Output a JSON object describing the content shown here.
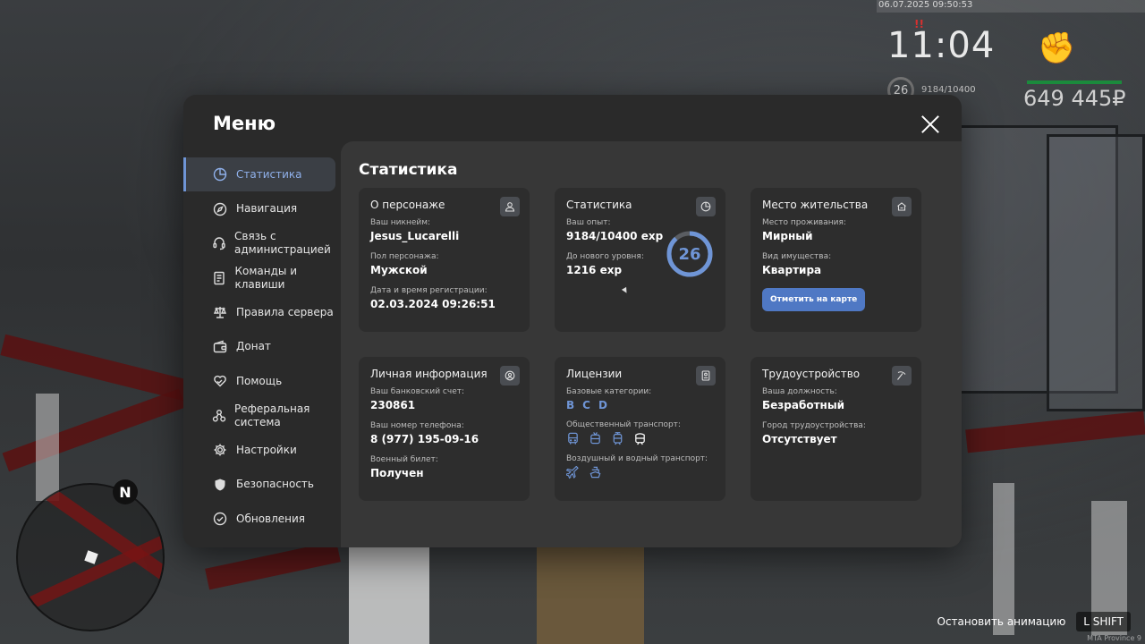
{
  "hud": {
    "datetime": "06.07.2025 09:50:53",
    "alert": "!!",
    "time": "11:04",
    "level": "26",
    "exp": "9184/10400",
    "money": "649 445₽",
    "health_color": "#1b8a3c"
  },
  "minimap": {
    "north": "N"
  },
  "hint": {
    "label": "Остановить анимацию",
    "key": "L SHIFT",
    "watermark": "MTA Province 9"
  },
  "menu": {
    "title": "Меню"
  },
  "sidebar": {
    "items": [
      {
        "label": "Статистика",
        "icon": "pie-chart-icon",
        "active": true
      },
      {
        "label": "Навигация",
        "icon": "compass-icon"
      },
      {
        "label": "Связь с администрацией",
        "icon": "headset-icon"
      },
      {
        "label": "Команды и клавиши",
        "icon": "document-icon"
      },
      {
        "label": "Правила сервера",
        "icon": "scales-icon"
      },
      {
        "label": "Донат",
        "icon": "wallet-icon"
      },
      {
        "label": "Помощь",
        "icon": "heart-hand-icon"
      },
      {
        "label": "Реферальная система",
        "icon": "network-icon"
      },
      {
        "label": "Настройки",
        "icon": "gear-icon"
      },
      {
        "label": "Безопасность",
        "icon": "shield-icon"
      },
      {
        "label": "Обновления",
        "icon": "check-circle-icon"
      }
    ]
  },
  "content": {
    "title": "Статистика",
    "character": {
      "title": "О персонаже",
      "nickname_label": "Ваш никнейм:",
      "nickname": "Jesus_Lucarelli",
      "gender_label": "Пол персонажа:",
      "gender": "Мужской",
      "reg_label": "Дата и время регистрации:",
      "reg": "02.03.2024 09:26:51"
    },
    "stats": {
      "title": "Статистика",
      "exp_label": "Ваш опыт:",
      "exp": "9184/10400 exp",
      "next_label": "До нового уровня:",
      "next": "1216 exp",
      "level": "26",
      "progress": 0.883,
      "accent": "#6f95d6"
    },
    "residence": {
      "title": "Место жительства",
      "place_label": "Место проживания:",
      "place": "Мирный",
      "type_label": "Вид имущества:",
      "type": "Квартира",
      "button": "Отметить на карте"
    },
    "personal": {
      "title": "Личная информация",
      "bank_label": "Ваш банковский счет:",
      "bank": "230861",
      "phone_label": "Ваш номер телефона:",
      "phone": "8 (977) 195-09-16",
      "military_label": "Военный билет:",
      "military": "Получен"
    },
    "licenses": {
      "title": "Лицензии",
      "base_label": "Базовые категории:",
      "categories": [
        "B",
        "C",
        "D"
      ],
      "public_label": "Общественный транспорт:",
      "public_icons": [
        "bus-icon",
        "trolleybus-icon",
        "tram-icon",
        "subway-icon"
      ],
      "air_label": "Воздушный и водный транспорт:",
      "air_icons": [
        "plane-icon",
        "boat-icon"
      ]
    },
    "job": {
      "title": "Трудоустройство",
      "position_label": "Ваша должность:",
      "position": "Безработный",
      "city_label": "Город трудоустройства:",
      "city": "Отсутствует"
    }
  }
}
